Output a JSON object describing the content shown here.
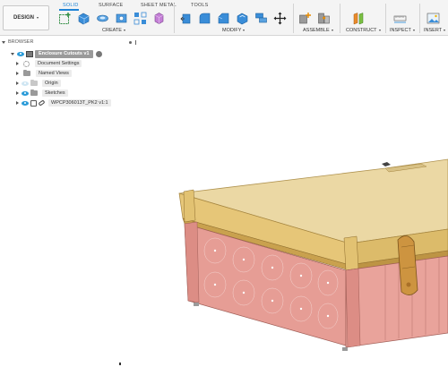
{
  "toolbar": {
    "workspace_button": "DESIGN",
    "tabs": [
      {
        "label": "SOLID",
        "active": true
      },
      {
        "label": "SURFACE",
        "active": false
      },
      {
        "label": "SHEET METAL",
        "active": false
      },
      {
        "label": "TOOLS",
        "active": false
      }
    ],
    "groups": {
      "create": "CREATE",
      "modify": "MODIFY",
      "assemble": "ASSEMBLE",
      "construct": "CONSTRUCT",
      "inspect": "INSPECT",
      "insert": "INSERT"
    }
  },
  "browser": {
    "title": "BROWSER",
    "items": [
      {
        "label": "Enclosure Cutouts v1",
        "icon": "component-icon"
      },
      {
        "label": "Document Settings",
        "icon": "gear-icon"
      },
      {
        "label": "Named Views",
        "icon": "folder-icon"
      },
      {
        "label": "Origin",
        "icon": "folder-icon"
      },
      {
        "label": "Sketches",
        "icon": "folder-icon"
      },
      {
        "label": "WPCP306013T_PK2 v1:1",
        "icon": "link-icon"
      }
    ]
  },
  "colors": {
    "accent": "#1f84d6",
    "lid": "#e9d7a3",
    "body": "#e59c94",
    "latch": "#c9903c"
  }
}
